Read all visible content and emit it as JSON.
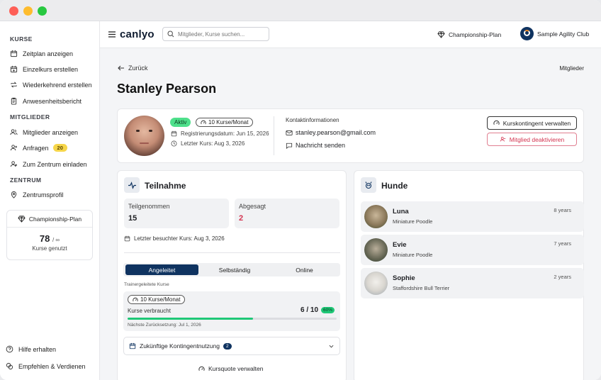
{
  "sidebar": {
    "sections": [
      {
        "title": "KURSE",
        "items": [
          "Zeitplan anzeigen",
          "Einzelkurs erstellen",
          "Wiederkehrend erstellen",
          "Anwesenheitsbericht"
        ]
      },
      {
        "title": "MITGLIEDER",
        "items": [
          "Mitglieder anzeigen",
          "Anfragen",
          "Zum Zentrum einladen"
        ]
      },
      {
        "title": "ZENTRUM",
        "items": [
          "Zentrumsprofil"
        ]
      }
    ],
    "requests_badge": "20",
    "plan_card": {
      "title": "Championship-Plan",
      "used": "78",
      "limit": "/ ∞",
      "label": "Kurse genutzt"
    },
    "footer": [
      "Hilfe erhalten",
      "Empfehlen & Verdienen"
    ]
  },
  "topbar": {
    "brand": "canlyo",
    "search_placeholder": "Mitglieder, Kurse suchen...",
    "plan": "Championship-Plan",
    "club": "Sample Agility Club"
  },
  "page": {
    "back": "Zurück",
    "breadcrumb": "Mitglieder",
    "title": "Stanley Pearson"
  },
  "profile": {
    "status": "Aktiv",
    "quota_chip": "10 Kurse/Monat",
    "registered": "Registrierungsdatum: Jun 15, 2026",
    "last_course": "Letzter Kurs: Aug 3, 2026",
    "contact_title": "Kontaktinformationen",
    "email": "stanley.pearson@gmail.com",
    "message": "Nachricht senden",
    "btn_manage": "Kurskontingent verwalten",
    "btn_deactivate": "Mitglied deaktivieren"
  },
  "attendance": {
    "title": "Teilnahme",
    "attended_label": "Teilgenommen",
    "attended": "15",
    "cancelled_label": "Abgesagt",
    "cancelled": "2",
    "last_visited": "Letzter besuchter Kurs: Aug 3, 2026",
    "tabs": [
      "Angeleitet",
      "Selbständig",
      "Online"
    ],
    "section_label": "Trainergeleitete Kurse",
    "quota_chip": "10 Kurse/Monat",
    "used_label": "Kurse verbraucht",
    "used_value": "6 / 10",
    "percent_text": "60%",
    "percent": 0.6,
    "reset": "Nächste Zurücksetzung: Jul 1, 2026",
    "future_label": "Zukünftige Kontingentnutzung",
    "future_count": "2",
    "manage_quota": "Kursquote verwalten"
  },
  "dogs": {
    "title": "Hunde",
    "items": [
      {
        "name": "Luna",
        "breed": "Miniature Poodle",
        "age": "8 years"
      },
      {
        "name": "Evie",
        "breed": "Miniature Poodle",
        "age": "7 years"
      },
      {
        "name": "Sophie",
        "breed": "Staffordshire Bull Terrier",
        "age": "2 years"
      }
    ]
  },
  "colors": {
    "accent": "#0f3360",
    "active_green": "#4ee08b",
    "danger": "#d3334f",
    "progress": "#1fc877"
  }
}
